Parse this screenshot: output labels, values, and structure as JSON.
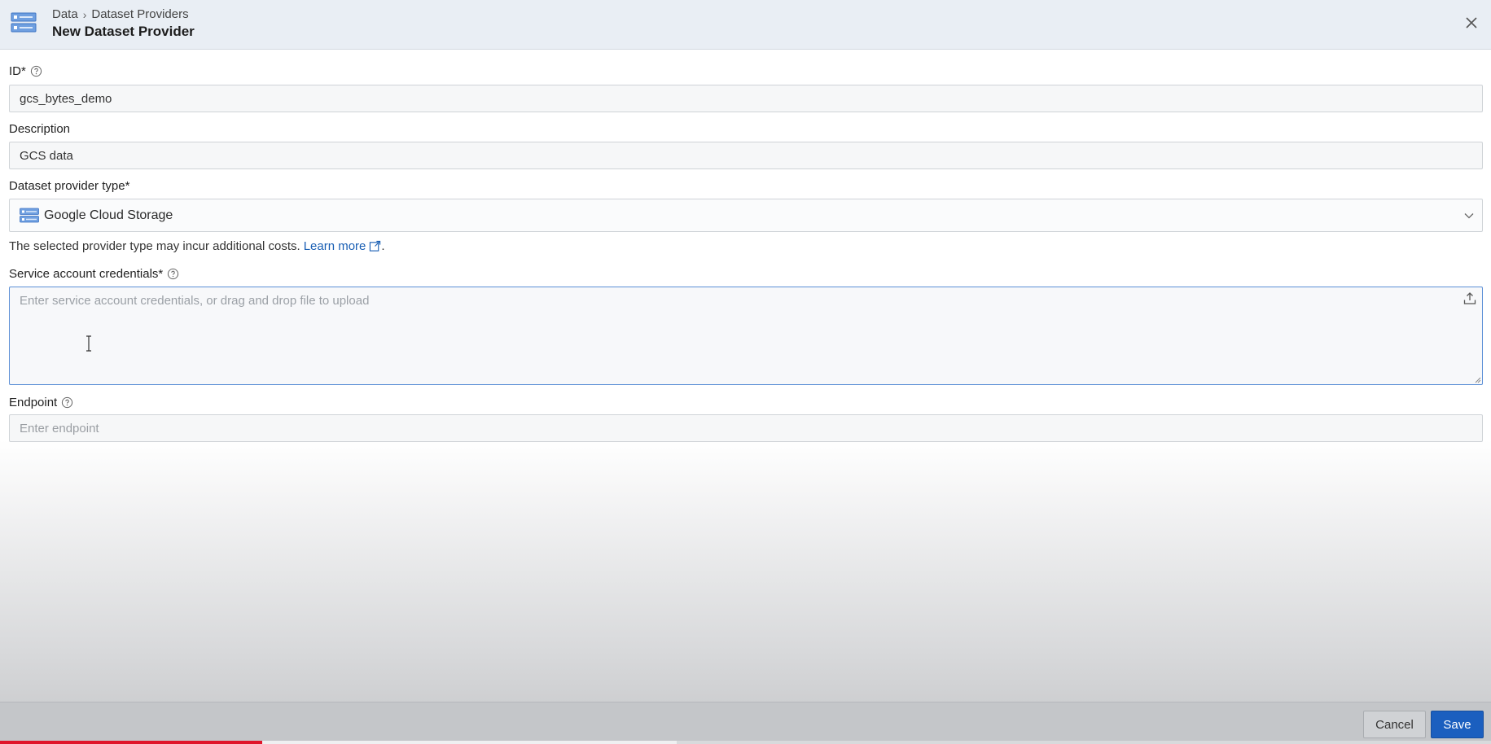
{
  "header": {
    "breadcrumb": [
      "Data",
      "Dataset Providers"
    ],
    "breadcrumb_separator": "›",
    "title": "New Dataset Provider",
    "icon": "dataset-provider-icon",
    "close_icon": "close-icon"
  },
  "form": {
    "id": {
      "label": "ID*",
      "value": "gcs_bytes_demo"
    },
    "description": {
      "label": "Description",
      "value": "GCS data"
    },
    "provider_type": {
      "label": "Dataset provider type*",
      "selected": "Google Cloud Storage",
      "icon": "google-cloud-storage-icon",
      "hint": "The selected provider type may incur additional costs.",
      "hint_link": "Learn more",
      "hint_suffix": "."
    },
    "credentials": {
      "label": "Service account credentials*",
      "placeholder": "Enter service account credentials, or drag and drop file to upload",
      "value": ""
    },
    "endpoint": {
      "label": "Endpoint",
      "placeholder": "Enter endpoint",
      "value": ""
    }
  },
  "footer": {
    "cancel_label": "Cancel",
    "save_label": "Save"
  },
  "video_progress": {
    "played_fraction": 0.176,
    "buffered_fraction": 0.454
  },
  "colors": {
    "accent": "#1b5fbf",
    "link": "#1a5fb4",
    "progress": "#e0162b",
    "header_bg": "#e9eef4"
  }
}
